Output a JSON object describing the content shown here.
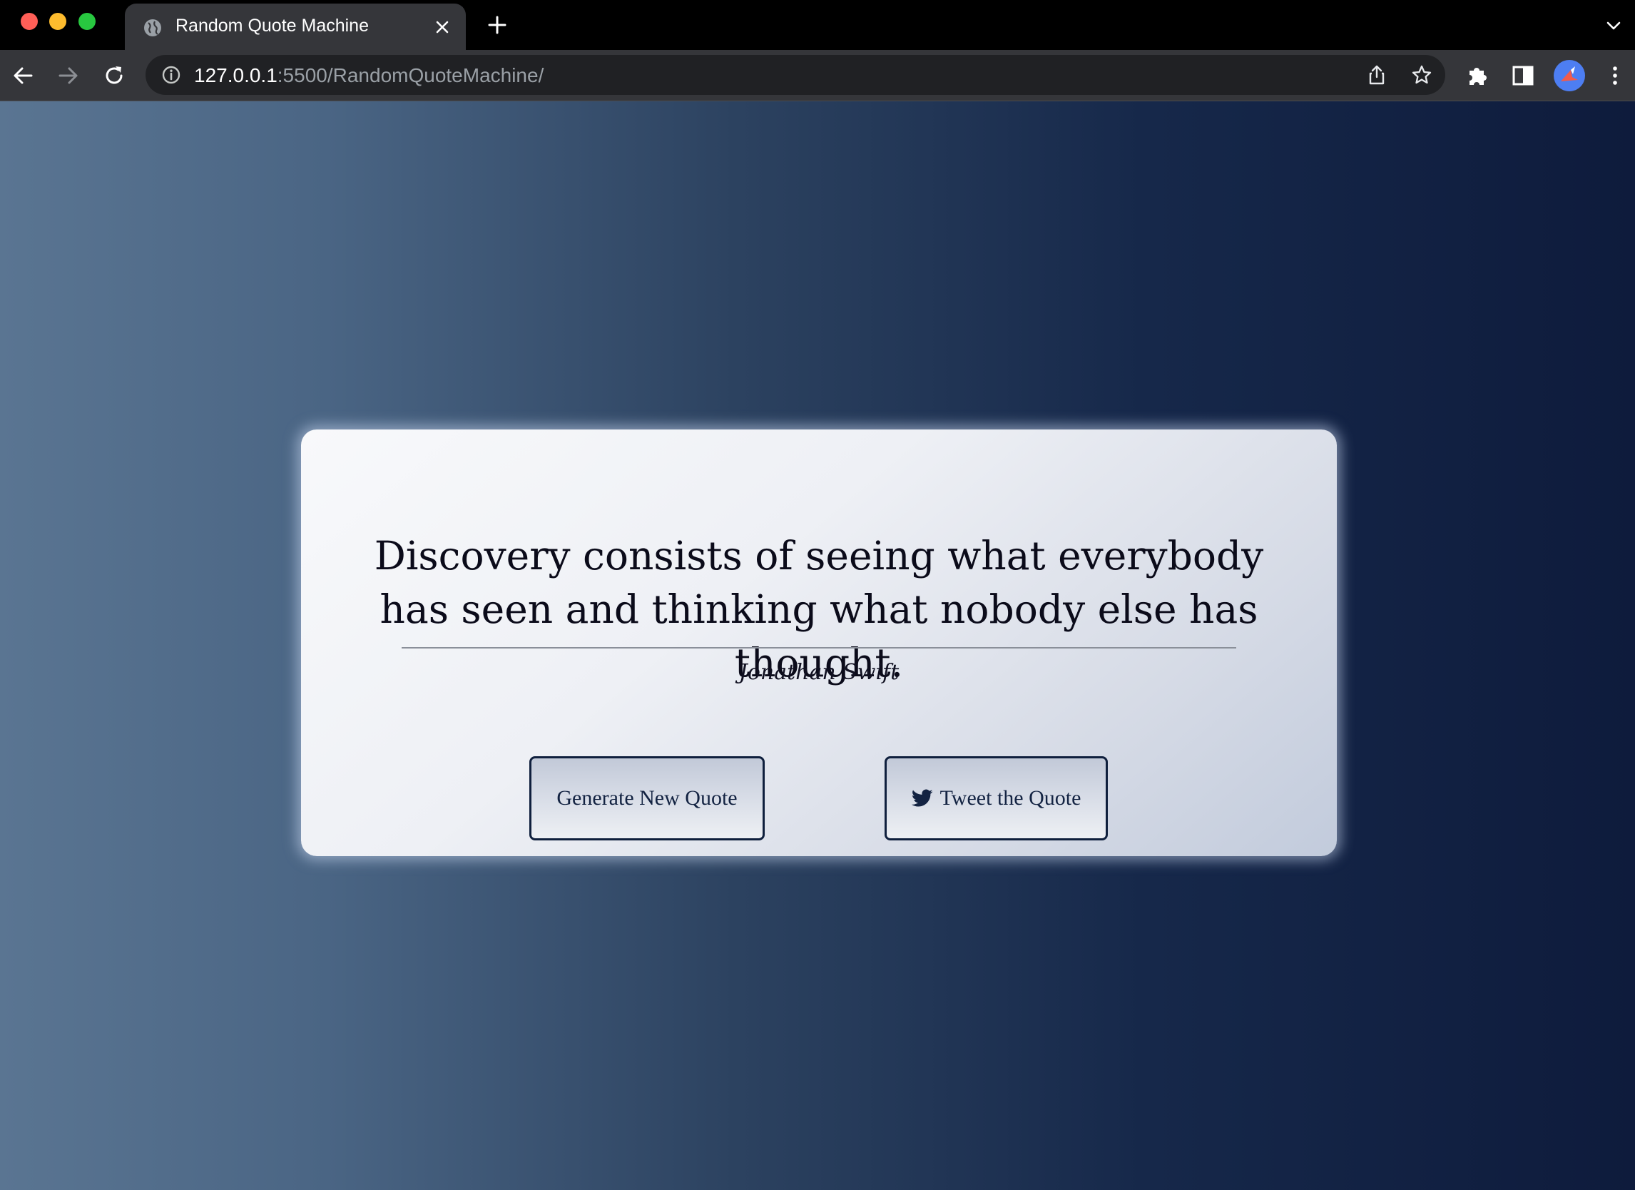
{
  "browser": {
    "tab": {
      "title": "Random Quote Machine",
      "favicon": "globe-icon",
      "close_icon": "close-icon"
    },
    "new_tab_icon": "plus-icon",
    "tab_list_icon": "chevron-down-icon",
    "nav": {
      "back_icon": "arrow-left-icon",
      "forward_icon": "arrow-right-icon",
      "reload_icon": "reload-icon"
    },
    "address_bar": {
      "host": "127.0.0.1",
      "rest": ":5500/RandomQuoteMachine/",
      "info_icon": "info-icon",
      "share_icon": "share-icon",
      "bookmark_icon": "star-icon"
    },
    "toolbar_icons": [
      "puzzle-icon",
      "side-panel-icon",
      "avatar",
      "more-vertical-icon"
    ]
  },
  "colors": {
    "window_frame": "#000000",
    "toolbar": "#35363a",
    "omnibox": "#202124",
    "gradient_left": "#5a7592",
    "gradient_right": "#0e1b3c",
    "card_light": "#f8f9fb",
    "card_dark": "#c2cbdc",
    "button_border": "#0f1f3d",
    "text_dark": "#0b0b1a"
  },
  "quote_box": {
    "text": "Discovery consists of seeing what everybody has seen and thinking what nobody else has thought.",
    "author": "Jonathan Swift",
    "buttons": {
      "new_quote": "Generate New Quote",
      "tweet": "Tweet the Quote",
      "tweet_icon": "twitter-icon"
    }
  }
}
